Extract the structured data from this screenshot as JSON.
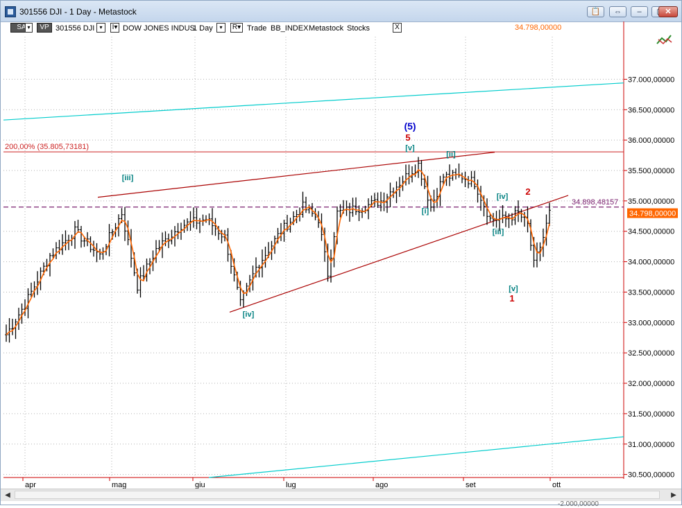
{
  "window": {
    "title": "301556 DJI - 1 Day - Metastock",
    "buttons": [
      "📋",
      "⇔",
      "‒",
      "▢",
      "✕"
    ]
  },
  "toolbar": {
    "sa": "SA",
    "vp": "VP",
    "symbol": "301556 DJI",
    "i_btn": "I▾",
    "name": "DOW JONES INDUS",
    "period": "1 Day",
    "r_btn": "R▾",
    "trade": "Trade",
    "index": "BB_INDEX",
    "source": "Metastock",
    "type": "Stocks",
    "close": "X",
    "last_price": "34.798,00000"
  },
  "chart_data": {
    "type": "candlestick",
    "x_ticks": [
      "apr",
      "mag",
      "giu",
      "lug",
      "ago",
      "set",
      "ott"
    ],
    "y_ticks": [
      "37.000,00000",
      "36.500,00000",
      "36.000,00000",
      "35.500,00000",
      "35.000,00000",
      "34.500,00000",
      "34.000,00000",
      "33.500,00000",
      "33.000,00000",
      "32.500,00000",
      "32.000,00000",
      "31.500,00000",
      "31.000,00000",
      "30.500,00000"
    ],
    "ylim": [
      30450,
      37700
    ],
    "fib_label": "200,00% (35.805,73181)",
    "fib_level": 35805.73,
    "dashed_level": 34898.48,
    "dashed_label": "34.898,48157",
    "current_price": "34.798,00000",
    "bottom_partial_label": "-2.000,00000",
    "wave_labels": [
      {
        "text": "(5)",
        "color": "#0000cc"
      },
      {
        "text": "5",
        "color": "#cc0000"
      },
      {
        "text": "[v]",
        "color": "#008080"
      },
      {
        "text": "[ii]",
        "color": "#008080"
      },
      {
        "text": "[iii]",
        "color": "#008080"
      },
      {
        "text": "[iv]",
        "color": "#008080"
      },
      {
        "text": "[i]",
        "color": "#008080"
      },
      {
        "text": "[iii]",
        "color": "#008080"
      },
      {
        "text": "[iv]",
        "color": "#008080"
      },
      {
        "text": "[v]",
        "color": "#008080"
      },
      {
        "text": "1",
        "color": "#cc0000"
      },
      {
        "text": "2",
        "color": "#cc0000"
      }
    ],
    "key_prices": [
      {
        "date_index": 0,
        "price": 32800
      },
      {
        "date_index": 6,
        "price": 33300
      },
      {
        "date_index": 14,
        "price": 34100
      },
      {
        "date_index": 22,
        "price": 34500
      },
      {
        "date_index": 30,
        "price": 34100
      },
      {
        "date_index": 37,
        "price": 34800
      },
      {
        "date_index": 42,
        "price": 33600
      },
      {
        "date_index": 48,
        "price": 34200
      },
      {
        "date_index": 56,
        "price": 34600
      },
      {
        "date_index": 64,
        "price": 34700
      },
      {
        "date_index": 70,
        "price": 34400
      },
      {
        "date_index": 75,
        "price": 33300
      },
      {
        "date_index": 80,
        "price": 33900
      },
      {
        "date_index": 88,
        "price": 34500
      },
      {
        "date_index": 95,
        "price": 34900
      },
      {
        "date_index": 100,
        "price": 34700
      },
      {
        "date_index": 103,
        "price": 33800
      },
      {
        "date_index": 106,
        "price": 34800
      },
      {
        "date_index": 114,
        "price": 34900
      },
      {
        "date_index": 120,
        "price": 35000
      },
      {
        "date_index": 126,
        "price": 35300
      },
      {
        "date_index": 132,
        "price": 35600
      },
      {
        "date_index": 136,
        "price": 34900
      },
      {
        "date_index": 140,
        "price": 35400
      },
      {
        "date_index": 146,
        "price": 35400
      },
      {
        "date_index": 150,
        "price": 35300
      },
      {
        "date_index": 155,
        "price": 34700
      },
      {
        "date_index": 160,
        "price": 34700
      },
      {
        "date_index": 164,
        "price": 34800
      },
      {
        "date_index": 167,
        "price": 34600
      },
      {
        "date_index": 169,
        "price": 33950
      },
      {
        "date_index": 172,
        "price": 34400
      },
      {
        "date_index": 174,
        "price": 34800
      }
    ]
  },
  "colors": {
    "grid": "#b0b0b0",
    "axis": "#cc0000",
    "trend": "#aa0000",
    "channel": "#00cccc",
    "fib": "#cc2222",
    "dashed": "#7a1f6e",
    "candle": "#000000",
    "ma": "#ff6600",
    "wave_teal": "#008080",
    "wave_red": "#cc0000",
    "wave_blue": "#0000cc",
    "price_box": "#ff6600"
  }
}
